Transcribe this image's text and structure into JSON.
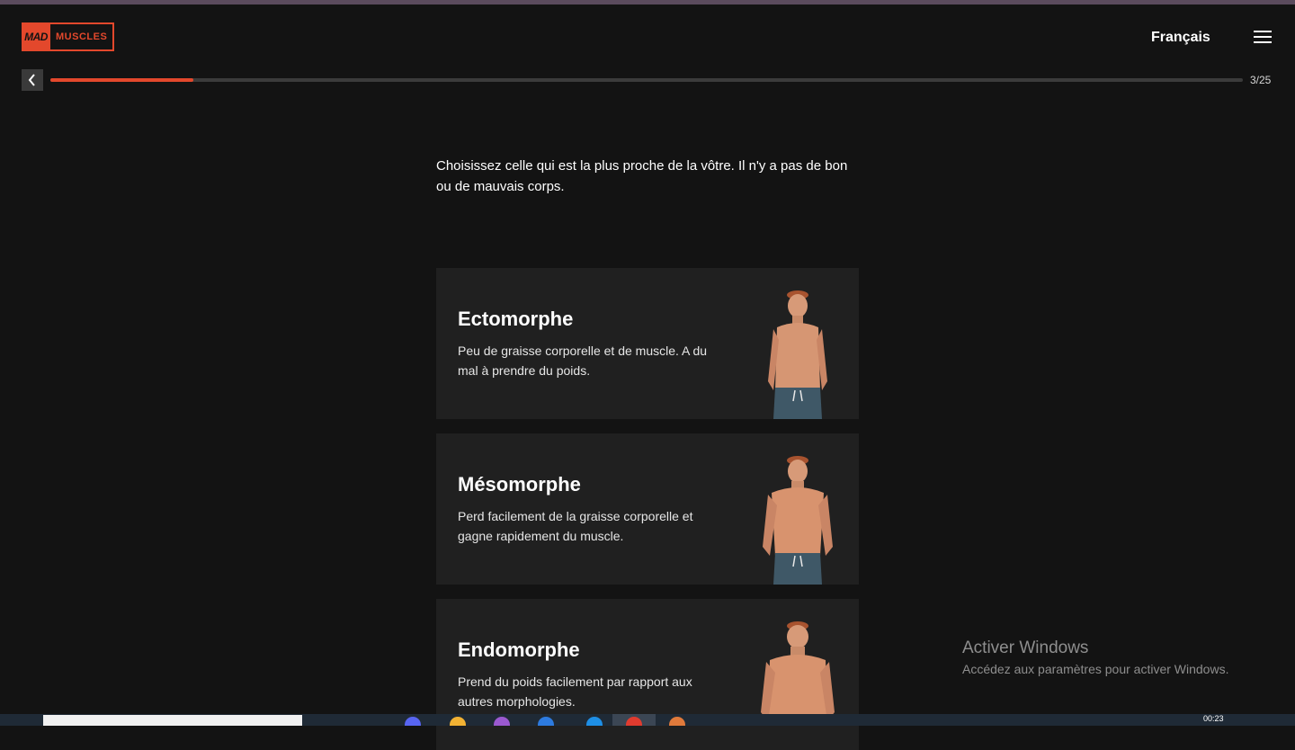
{
  "header": {
    "logo_part1": "MAD",
    "logo_part2": "MUSCLES",
    "language": "Français",
    "menu_icon": "hamburger-menu-icon"
  },
  "progress": {
    "step_label": "3/25",
    "fraction": 0.12,
    "back_icon": "chevron-left-icon",
    "color": "#e3482c"
  },
  "question": {
    "instruction": "Choisissez celle qui est la plus proche de la vôtre. Il n'y a pas de bon ou de mauvais corps."
  },
  "options": [
    {
      "title": "Ectomorphe",
      "description": "Peu de graisse corporelle et de muscle. A du mal à prendre du poids."
    },
    {
      "title": "Mésomorphe",
      "description": "Perd facilement de la graisse corporelle et gagne rapidement du muscle."
    },
    {
      "title": "Endomorphe",
      "description": "Prend du poids facilement par rapport aux autres morphologies."
    }
  ],
  "watermark": {
    "title": "Activer Windows",
    "subtitle": "Accédez aux paramètres pour activer Windows."
  },
  "taskbar": {
    "time": "00:23"
  }
}
